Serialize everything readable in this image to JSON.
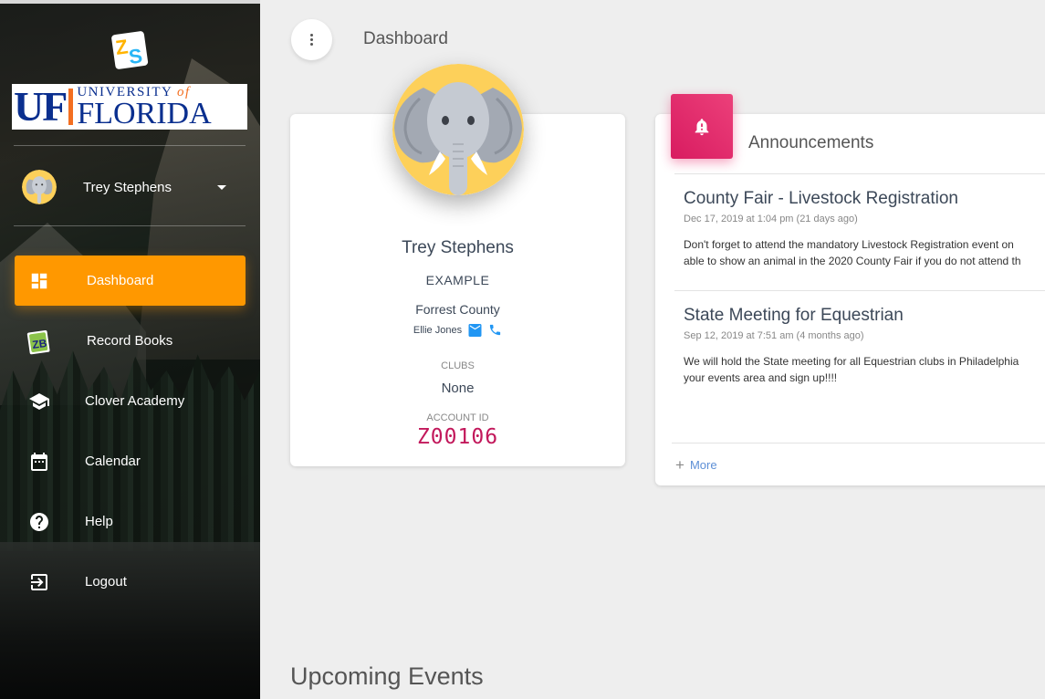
{
  "sidebar": {
    "logo_uf_big": "UF",
    "logo_uf_university": "UNIVERSITY",
    "logo_uf_of": "of",
    "logo_uf_florida": "FLORIDA",
    "user_name": "Trey Stephens",
    "nav": [
      {
        "label": "Dashboard",
        "icon": "dashboard-icon",
        "active": true
      },
      {
        "label": "Record Books",
        "icon": "record-books-icon",
        "active": false
      },
      {
        "label": "Clover Academy",
        "icon": "graduation-cap-icon",
        "active": false
      },
      {
        "label": "Calendar",
        "icon": "calendar-icon",
        "active": false
      },
      {
        "label": "Help",
        "icon": "help-icon",
        "active": false
      },
      {
        "label": "Logout",
        "icon": "logout-icon",
        "active": false
      }
    ]
  },
  "header": {
    "title": "Dashboard"
  },
  "profile": {
    "name": "Trey Stephens",
    "example": "EXAMPLE",
    "county": "Forrest County",
    "leader": "Ellie Jones",
    "clubs_label": "CLUBS",
    "clubs_value": "None",
    "account_label": "ACCOUNT ID",
    "account_id": "Z00106"
  },
  "announcements": {
    "title": "Announcements",
    "items": [
      {
        "title": "County Fair - Livestock Registration",
        "date": "Dec 17, 2019 at 1:04 pm (21 days ago)",
        "body_line1": "Don't forget to attend the mandatory Livestock Registration event on",
        "body_line2": "able to show an animal in the 2020 County Fair if you do not attend th"
      },
      {
        "title": "State Meeting for Equestrian",
        "date": "Sep 12, 2019 at 7:51 am (4 months ago)",
        "body_line1": "We will hold the State meeting for all Equestrian clubs in Philadelphia",
        "body_line2": "your events area and sign up!!!!"
      }
    ],
    "more_label": "More"
  },
  "upcoming": {
    "title": "Upcoming Events"
  },
  "colors": {
    "accent": "#ff9800",
    "announcement": "#e91e63",
    "account_id": "#c2185b"
  }
}
